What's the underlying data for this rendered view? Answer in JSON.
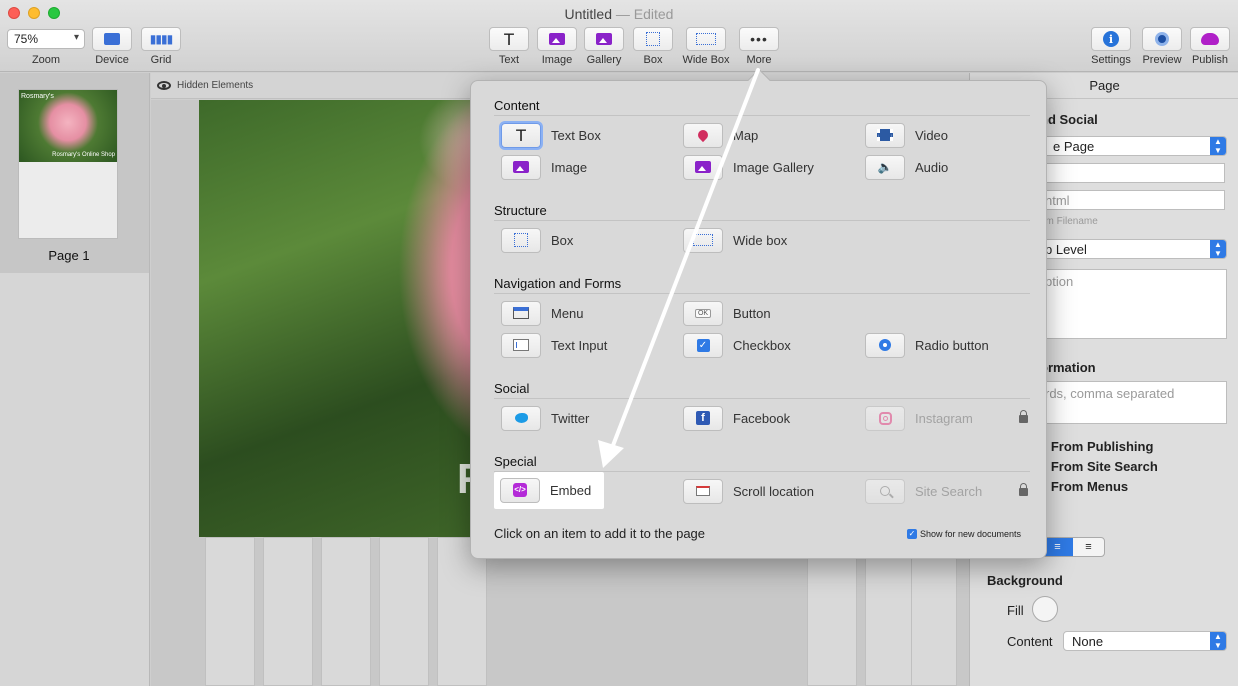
{
  "window": {
    "title": "Untitled",
    "edited": "— Edited"
  },
  "toolbar": {
    "zoom_value": "75%",
    "zoom_label": "Zoom",
    "device_label": "Device",
    "grid_label": "Grid",
    "text_label": "Text",
    "image_label": "Image",
    "gallery_label": "Gallery",
    "box_label": "Box",
    "widebox_label": "Wide Box",
    "more_label": "More",
    "settings_label": "Settings",
    "preview_label": "Preview",
    "publish_label": "Publish"
  },
  "sidebar": {
    "thumb_title": "Rosmary's",
    "thumb_caption": "Rosmary's Online Shop",
    "page_label": "Page 1"
  },
  "canvas": {
    "hidden_elements": "Hidden Elements",
    "hero_letter": "R"
  },
  "inspector": {
    "header": "Page",
    "seo_social": "nd Social",
    "page_select": "e Page",
    "filename_placeholder": "ntml",
    "filename_hint": "om Filename",
    "level_select": "p Level",
    "desc_placeholder": "ption",
    "information": "ormation",
    "keywords_placeholder": "rds, comma separated",
    "exclude_publishing": "e From Publishing",
    "exclude_search": "e From Site Search",
    "exclude_menus": "e From Menus",
    "alignment": "t",
    "background": "Background",
    "fill": "Fill",
    "content_label": "Content",
    "content_value": "None"
  },
  "popover": {
    "sections": {
      "content": "Content",
      "structure": "Structure",
      "navigation": "Navigation and Forms",
      "social": "Social",
      "special": "Special"
    },
    "items": {
      "text_box": "Text Box",
      "map": "Map",
      "video": "Video",
      "image": "Image",
      "image_gallery": "Image Gallery",
      "audio": "Audio",
      "box": "Box",
      "wide_box": "Wide box",
      "menu": "Menu",
      "button": "Button",
      "text_input": "Text Input",
      "checkbox": "Checkbox",
      "radio_button": "Radio button",
      "twitter": "Twitter",
      "facebook": "Facebook",
      "instagram": "Instagram",
      "embed": "Embed",
      "scroll_location": "Scroll location",
      "site_search": "Site Search"
    },
    "footer": "Click on an item to add it to the page",
    "show_new": "Show for new documents"
  },
  "colors": {
    "accent": "#2f7ae5",
    "embed_icon": "#b42ad8",
    "annotation_arrow": "#ffffff"
  }
}
